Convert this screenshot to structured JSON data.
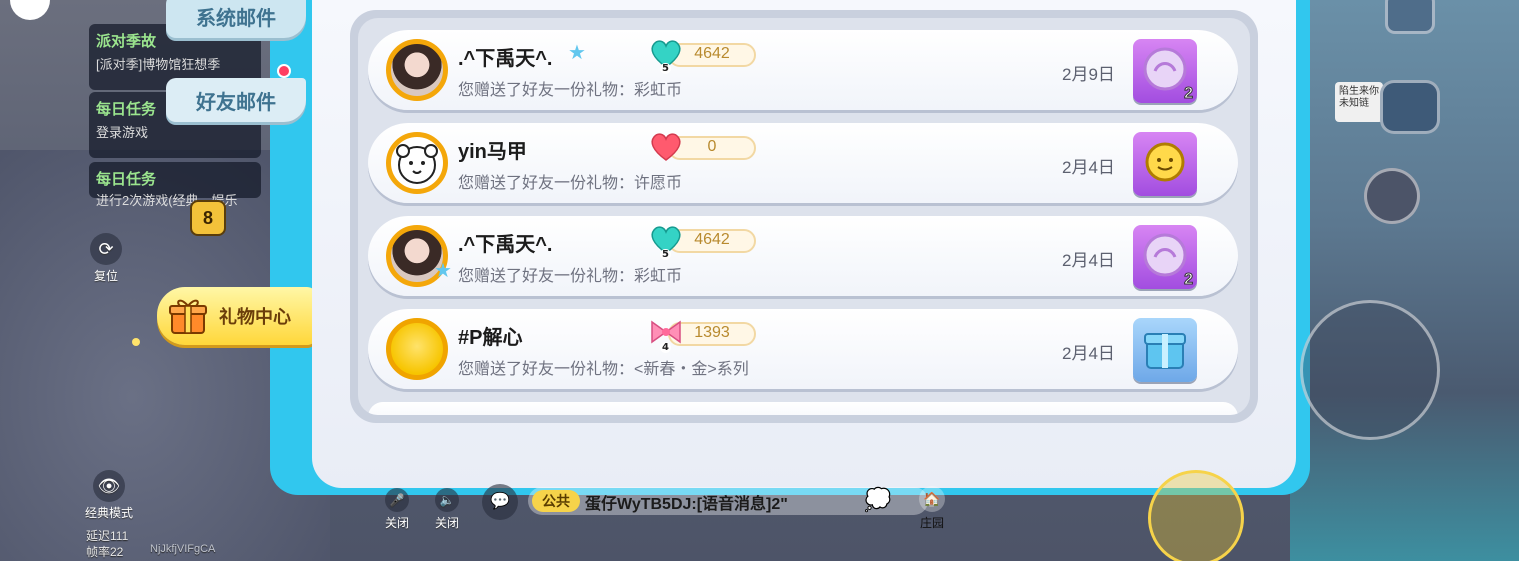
{
  "tabs": {
    "system_mail": "系统邮件",
    "friend_mail": "好友邮件"
  },
  "tasks": [
    {
      "title": "派对季故",
      "desc": "[派对季]博物馆狂想季"
    },
    {
      "title": "每日任务",
      "desc": "登录游戏"
    },
    {
      "title": "每日任务",
      "desc": "进行2次游戏(经典、娱乐"
    }
  ],
  "left_controls": {
    "reset": "复位",
    "classic_mode": "经典模式",
    "latency": "延迟111",
    "framerate": "帧率22",
    "user_id": "NjJkfjVIFgCA",
    "level_badge": "8"
  },
  "gift_center": {
    "label": "礼物中心"
  },
  "gift_rows": [
    {
      "name": ".^下禹天^.",
      "star_after_name": true,
      "star_on_avatar": false,
      "badge_value": "4642",
      "badge_level": "5",
      "badge_type": "teal-heart",
      "desc": "您赠送了好友一份礼物：彩虹币",
      "date": "2月9日",
      "gift_type": "rainbow-coin",
      "gift_qty": "2",
      "avatar_type": "photo"
    },
    {
      "name": "yin马甲",
      "star_after_name": false,
      "star_on_avatar": false,
      "badge_value": "0",
      "badge_level": "",
      "badge_type": "red-heart",
      "desc": "您赠送了好友一份礼物：许愿币",
      "date": "2月4日",
      "gift_type": "wish-coin",
      "gift_qty": "",
      "avatar_type": "bear"
    },
    {
      "name": ".^下禹天^.",
      "star_after_name": false,
      "star_on_avatar": true,
      "badge_value": "4642",
      "badge_level": "5",
      "badge_type": "teal-heart",
      "desc": "您赠送了好友一份礼物：彩虹币",
      "date": "2月4日",
      "gift_type": "rainbow-coin",
      "gift_qty": "2",
      "avatar_type": "photo"
    },
    {
      "name": "#P解心",
      "star_after_name": false,
      "star_on_avatar": false,
      "badge_value": "1393",
      "badge_level": "4",
      "badge_type": "pink-bow",
      "desc": "您赠送了好友一份礼物：<新春・金>系列",
      "date": "2月4日",
      "gift_type": "new-year-box",
      "gift_qty": "",
      "avatar_type": "sun"
    }
  ],
  "bottom": {
    "mic_label": "关闭",
    "speaker_label": "关闭",
    "chat_channel": "公共",
    "chat_message": "蛋仔WyTB5DJ:[语音消息]2\"",
    "home_label": "庄园"
  },
  "right_sign": "陷生来你 未知链",
  "colors": {
    "frame_blue": "#31c7ee",
    "accent_yellow": "#f6d34a",
    "tab_text": "#3f7390",
    "notify_red": "#ff3e62"
  }
}
